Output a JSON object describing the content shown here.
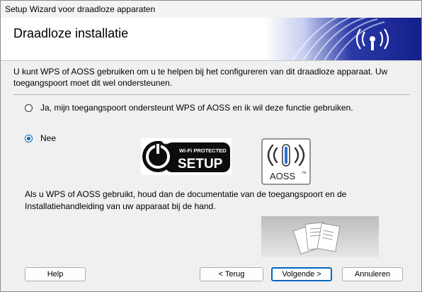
{
  "window": {
    "title": "Setup Wizard voor draadloze apparaten"
  },
  "header": {
    "title": "Draadloze installatie"
  },
  "intro": {
    "text": "U kunt WPS of AOSS gebruiken om u te helpen bij het configureren van dit draadloze apparaat. Uw toegangspoort moet dit wel ondersteunen."
  },
  "options": [
    {
      "label": "Ja, mijn toegangspoort ondersteunt WPS of AOSS en ik wil deze functie gebruiken.",
      "selected": false
    },
    {
      "label": "Nee",
      "selected": true
    }
  ],
  "logos": {
    "wps": {
      "line1": "Wi-Fi PROTECTED",
      "line2": "SETUP"
    },
    "aoss": {
      "text": "AOSS",
      "mark": "TM"
    }
  },
  "note": {
    "text": "Als u WPS of AOSS gebruikt, houd dan de documentatie van de toegangspoort en de Installatiehandleiding van uw apparaat bij de hand."
  },
  "buttons": {
    "help": "Help",
    "back": "< Terug",
    "next": "Volgende >",
    "cancel": "Annuleren"
  },
  "colors": {
    "accent": "#0067c0",
    "brand_blue": "#1a2a9a",
    "radio_selected": "#0a5fb4"
  }
}
